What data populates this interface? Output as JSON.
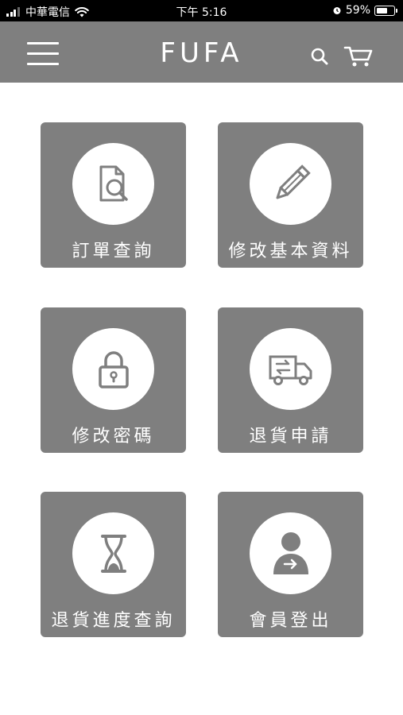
{
  "status_bar": {
    "carrier": "中華電信",
    "time": "下午 5:16",
    "battery_percent": "59%"
  },
  "navbar": {
    "brand": "FUFA",
    "icons": [
      "menu-icon",
      "search-icon",
      "cart-icon"
    ]
  },
  "menu": {
    "tiles": [
      {
        "label": "訂單查詢",
        "icon": "document-search-icon"
      },
      {
        "label": "修改基本資料",
        "icon": "pencil-icon"
      },
      {
        "label": "修改密碼",
        "icon": "lock-icon"
      },
      {
        "label": "退貨申請",
        "icon": "return-truck-icon"
      },
      {
        "label": "退貨進度查詢",
        "icon": "hourglass-icon"
      },
      {
        "label": "會員登出",
        "icon": "user-logout-icon"
      }
    ]
  },
  "colors": {
    "tile_background": "#7f7f7f",
    "navbar_background": "#7f7f7f",
    "icon_stroke": "#7f7f7f",
    "text": "#ffffff"
  }
}
